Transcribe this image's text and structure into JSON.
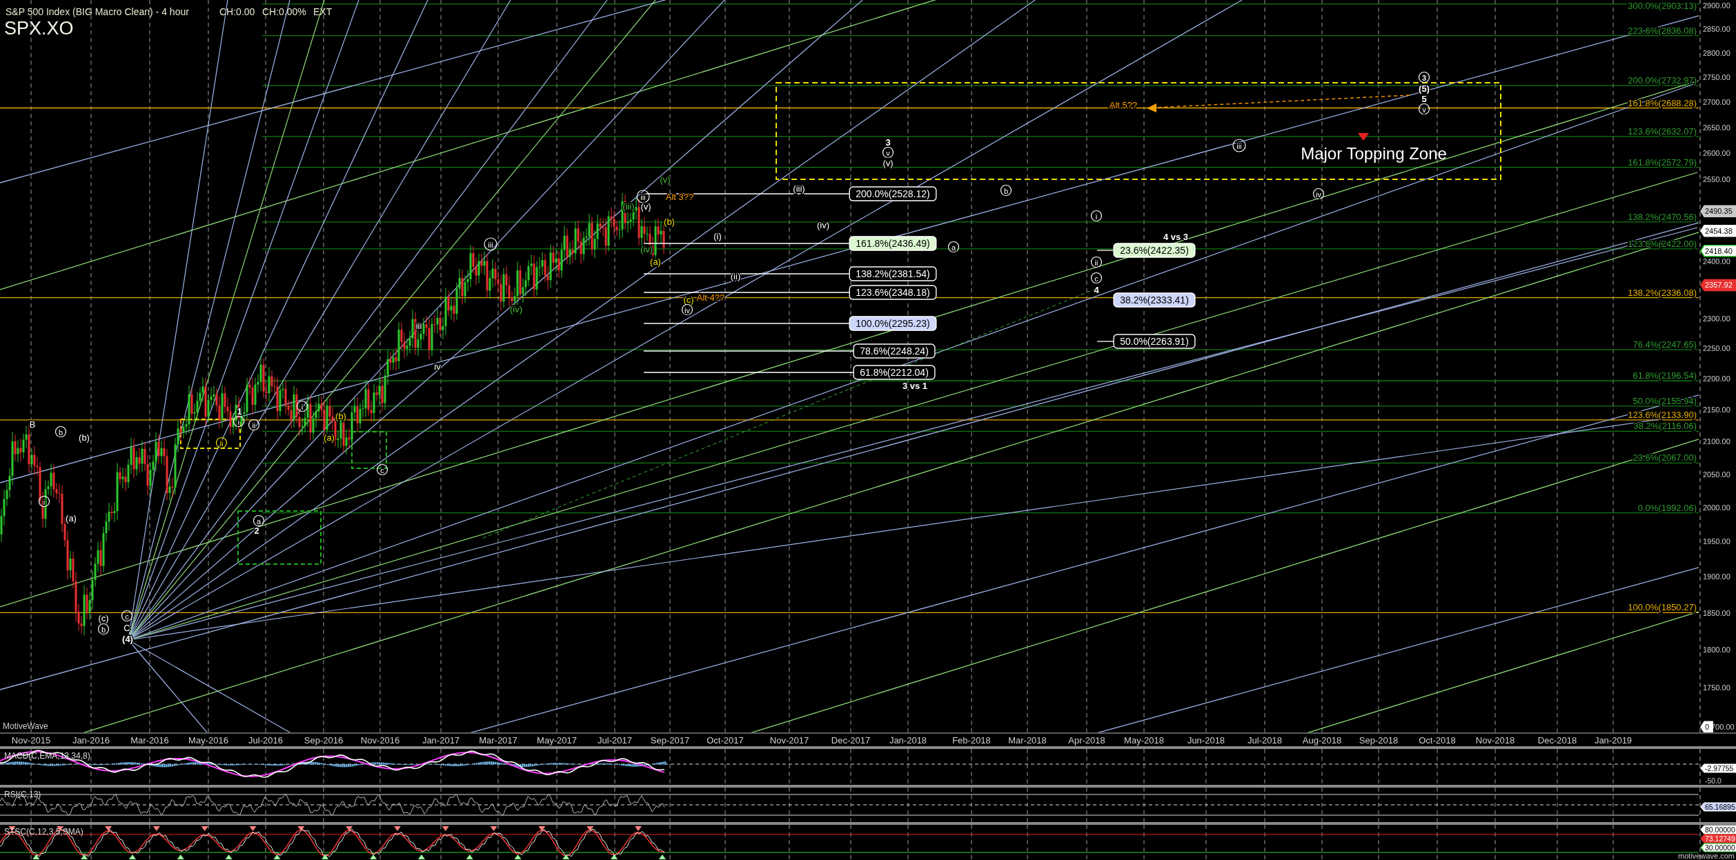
{
  "header": {
    "title": "S&P 500 Index (BIG Macro Clean) - 4 hour",
    "change": "CH:0.00",
    "change_pct": "CH:0.00%",
    "session": "EXT",
    "symbol": "SPX.XO"
  },
  "price_axis": {
    "labels": [
      "2900.00",
      "2850.00",
      "2800.00",
      "2750.00",
      "2700.00",
      "2650.00",
      "2600.00",
      "2550.00",
      "2400.00",
      "2300.00",
      "2250.00",
      "2200.00",
      "2150.00",
      "2100.00",
      "2050.00",
      "2000.00",
      "1950.00",
      "1900.00",
      "1850.00",
      "1800.00",
      "1750.00",
      "700.00"
    ],
    "markers": [
      {
        "text": "2490.35",
        "kind": "grey"
      },
      {
        "text": "2454.38",
        "kind": "white"
      },
      {
        "text": "2418.40",
        "kind": "green"
      },
      {
        "text": "2357.92",
        "kind": "red"
      },
      {
        "text": "0",
        "kind": "white"
      }
    ]
  },
  "fib_levels": [
    {
      "text": "300.0%(2903.13)",
      "kind": "green"
    },
    {
      "text": "223.6%(2836.08)",
      "kind": "green"
    },
    {
      "text": "200.0%(2732.97)",
      "kind": "green"
    },
    {
      "text": "161.8%(2688.28)",
      "kind": "yellow"
    },
    {
      "text": "123.6%(2632.07)",
      "kind": "green"
    },
    {
      "text": "161.8%(2572.79)",
      "kind": "green"
    },
    {
      "text": "138.2%(2470.56)",
      "kind": "green"
    },
    {
      "text": "123.6%(2422.00)",
      "kind": "green"
    },
    {
      "text": "138.2%(2336.08)",
      "kind": "yellow"
    },
    {
      "text": "76.4%(2247.65)",
      "kind": "green"
    },
    {
      "text": "61.8%(2196.54)",
      "kind": "green"
    },
    {
      "text": "50.0%(2155.94)",
      "kind": "green"
    },
    {
      "text": "123.6%(2133.90)",
      "kind": "yellow"
    },
    {
      "text": "38.2%(2116.06)",
      "kind": "green"
    },
    {
      "text": "23.6%(2067.00)",
      "kind": "green"
    },
    {
      "text": "0.0%(1992.06)",
      "kind": "green"
    },
    {
      "text": "100.0%(1850.27)",
      "kind": "yellow"
    }
  ],
  "fib_boxes": [
    {
      "text": "200.0%(2528.12)",
      "kind": "plain"
    },
    {
      "text": "161.8%(2436.49)",
      "kind": "green"
    },
    {
      "text": "138.2%(2381.54)",
      "kind": "plain"
    },
    {
      "text": "123.6%(2348.18)",
      "kind": "plain"
    },
    {
      "text": "100.0%(2295.23)",
      "kind": "blue"
    },
    {
      "text": "78.6%(2248.24)",
      "kind": "plain"
    },
    {
      "text": "61.8%(2212.04)",
      "kind": "plain"
    },
    {
      "text": "23.6%(2422.35)",
      "kind": "green"
    },
    {
      "text": "38.2%(2333.41)",
      "kind": "blue"
    },
    {
      "text": "50.0%(2263.91)",
      "kind": "plain"
    }
  ],
  "wave_labels": [
    {
      "text": "B",
      "circled": false,
      "kind": "white"
    },
    {
      "text": "b",
      "circled": true,
      "kind": "white"
    },
    {
      "text": "(b)",
      "circled": false,
      "kind": "white"
    },
    {
      "text": "i",
      "circled": true,
      "kind": "white"
    },
    {
      "text": "(a)",
      "circled": false,
      "kind": "white"
    },
    {
      "text": "(c)",
      "circled": false,
      "kind": "white"
    },
    {
      "text": "b",
      "circled": true,
      "kind": "white"
    },
    {
      "text": "c",
      "circled": true,
      "kind": "white"
    },
    {
      "text": "C",
      "circled": false,
      "kind": "white"
    },
    {
      "text": "(4)",
      "circled": false,
      "kind": "bold"
    },
    {
      "text": "ii",
      "circled": true,
      "kind": "yellow"
    },
    {
      "text": "1",
      "circled": false,
      "kind": "bold"
    },
    {
      "text": "i",
      "circled": true,
      "kind": "white"
    },
    {
      "text": "ii",
      "circled": true,
      "kind": "white"
    },
    {
      "text": "a",
      "circled": true,
      "kind": "white"
    },
    {
      "text": "2",
      "circled": false,
      "kind": "bold"
    },
    {
      "text": "i",
      "circled": true,
      "kind": "white"
    },
    {
      "text": "(b)",
      "circled": false,
      "kind": "yellow"
    },
    {
      "text": "(a)",
      "circled": false,
      "kind": "yellow"
    },
    {
      "text": "c",
      "circled": true,
      "kind": "white"
    },
    {
      "text": "iii",
      "circled": false,
      "kind": "white"
    },
    {
      "text": "iv",
      "circled": false,
      "kind": "white"
    },
    {
      "text": "iii",
      "circled": true,
      "kind": "white"
    },
    {
      "text": "(iv)",
      "circled": false,
      "kind": "green"
    },
    {
      "text": "iii",
      "circled": true,
      "kind": "white"
    },
    {
      "text": "Alt 3??",
      "circled": false,
      "kind": "orange"
    },
    {
      "text": "(iii)",
      "circled": false,
      "kind": "green"
    },
    {
      "text": "(v)",
      "circled": false,
      "kind": "white"
    },
    {
      "text": "(v)",
      "circled": false,
      "kind": "green"
    },
    {
      "text": "(b)",
      "circled": false,
      "kind": "yellow"
    },
    {
      "text": "(iv)",
      "circled": false,
      "kind": "green"
    },
    {
      "text": "(a)",
      "circled": false,
      "kind": "yellow"
    },
    {
      "text": "(i)",
      "circled": false,
      "kind": "white"
    },
    {
      "text": "(ii)",
      "circled": false,
      "kind": "white"
    },
    {
      "text": "(c)",
      "circled": false,
      "kind": "yellow"
    },
    {
      "text": "Alt 4??",
      "circled": false,
      "kind": "orange"
    },
    {
      "text": "iv",
      "circled": true,
      "kind": "white"
    },
    {
      "text": "(iii)",
      "circled": false,
      "kind": "white"
    },
    {
      "text": "(iv)",
      "circled": false,
      "kind": "white"
    },
    {
      "text": "a",
      "circled": true,
      "kind": "white"
    },
    {
      "text": "b",
      "circled": true,
      "kind": "white"
    },
    {
      "text": "i",
      "circled": true,
      "kind": "white"
    },
    {
      "text": "ii",
      "circled": true,
      "kind": "white"
    },
    {
      "text": "c",
      "circled": true,
      "kind": "white"
    },
    {
      "text": "4",
      "circled": false,
      "kind": "bold"
    },
    {
      "text": "4 vs 3",
      "circled": false,
      "kind": "bold"
    },
    {
      "text": "3 vs 1",
      "circled": false,
      "kind": "bold"
    },
    {
      "text": "3",
      "circled": false,
      "kind": "bold"
    },
    {
      "text": "v",
      "circled": true,
      "kind": "white"
    },
    {
      "text": "(v)",
      "circled": false,
      "kind": "white"
    },
    {
      "text": "Alt 5??",
      "circled": false,
      "kind": "orange"
    },
    {
      "text": "3",
      "circled": true,
      "kind": "bold"
    },
    {
      "text": "(5)",
      "circled": false,
      "kind": "bold"
    },
    {
      "text": "5",
      "circled": false,
      "kind": "bold"
    },
    {
      "text": "v",
      "circled": true,
      "kind": "white"
    },
    {
      "text": "iii",
      "circled": true,
      "kind": "white"
    },
    {
      "text": "iv",
      "circled": true,
      "kind": "white"
    }
  ],
  "zone_label": "Major Topping Zone",
  "app_label": "MotiveWave",
  "time_axis": [
    "Nov-2015",
    "Jan-2016",
    "Mar-2016",
    "May-2016",
    "Jul-2016",
    "Sep-2016",
    "Nov-2016",
    "Jan-2017",
    "Mar-2017",
    "May-2017",
    "Jul-2017",
    "Sep-2017",
    "Oct-2017",
    "Nov-2017",
    "Dec-2017",
    "Jan-2018",
    "Feb-2018",
    "Mar-2018",
    "Apr-2018",
    "May-2018",
    "Jun-2018",
    "Jul-2018",
    "Aug-2018",
    "Sep-2018",
    "Oct-2018",
    "Nov-2018",
    "Dec-2018",
    "Jan-2019"
  ],
  "indicators": [
    {
      "kind": "macd",
      "title": "MACD(C,EMA,13,34,8)",
      "values": [
        {
          "text": "-2.97755",
          "kind": "white"
        },
        {
          "text": "-50.0",
          "kind": "plain"
        }
      ]
    },
    {
      "kind": "rsi",
      "title": "RSI(C,13)",
      "values": [
        {
          "text": "65.16895",
          "kind": "blue"
        }
      ]
    },
    {
      "kind": "stoch",
      "title": "STSC(C,12,3,5,SMA)",
      "values": [
        {
          "text": "80.00000",
          "kind": "white"
        },
        {
          "text": "73.12749",
          "kind": "red"
        },
        {
          "text": "30.00000",
          "kind": "green"
        }
      ]
    }
  ],
  "footer": "motivewave.com"
}
